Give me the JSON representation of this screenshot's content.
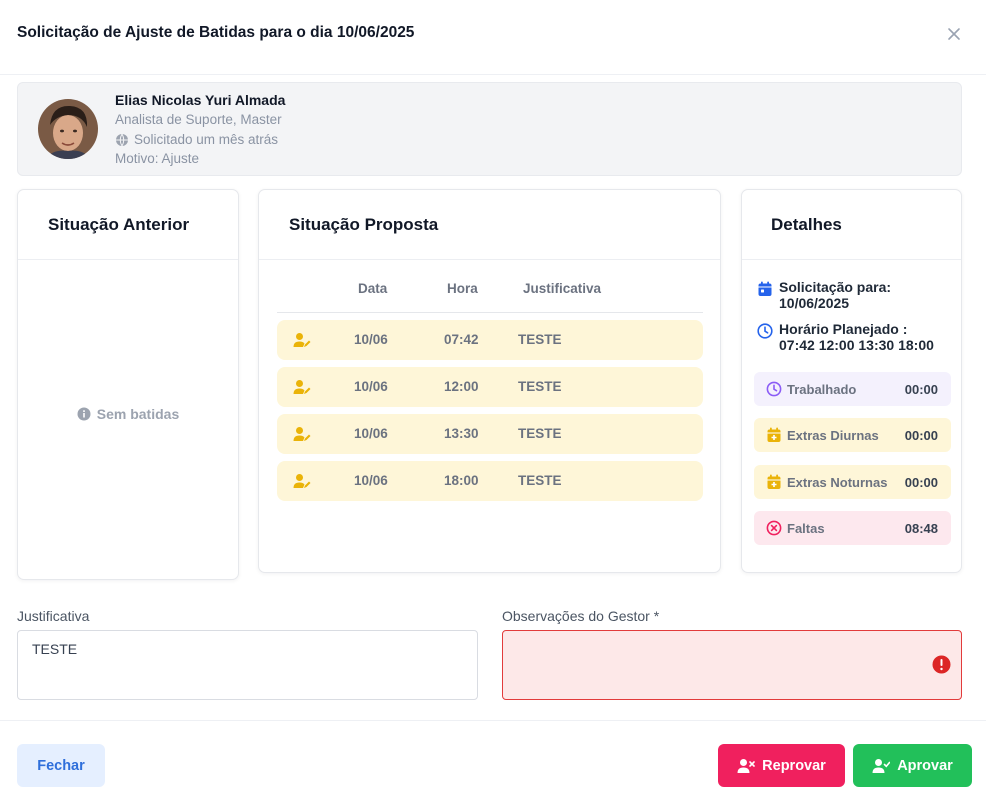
{
  "modal": {
    "title": "Solicitação de Ajuste de Batidas para o dia 10/06/2025"
  },
  "employee": {
    "name": "Elias Nicolas Yuri Almada",
    "role": "Analista de Suporte, Master",
    "requested": "Solicitado um mês atrás",
    "reason": "Motivo: Ajuste"
  },
  "previous": {
    "title": "Situação Anterior",
    "empty_text": "Sem batidas"
  },
  "proposed": {
    "title": "Situação Proposta",
    "columns": {
      "date": "Data",
      "time": "Hora",
      "justification": "Justificativa"
    },
    "rows": [
      {
        "date": "10/06",
        "time": "07:42",
        "justification": "TESTE"
      },
      {
        "date": "10/06",
        "time": "12:00",
        "justification": "TESTE"
      },
      {
        "date": "10/06",
        "time": "13:30",
        "justification": "TESTE"
      },
      {
        "date": "10/06",
        "time": "18:00",
        "justification": "TESTE"
      }
    ]
  },
  "details": {
    "title": "Detalhes",
    "request_for_label": "Solicitação para:",
    "request_for_value": "10/06/2025",
    "planned_label": "Horário Planejado :",
    "planned_value": "07:42 12:00 13:30 18:00",
    "stats": [
      {
        "label": "Trabalhado",
        "value": "00:00",
        "icon": "clock-icon",
        "bg": "#f4f1fd",
        "color": "#8b5cf6"
      },
      {
        "label": "Extras Diurnas",
        "value": "00:00",
        "icon": "calendar-plus-icon",
        "bg": "#fef6d8",
        "color": "#eab308"
      },
      {
        "label": "Extras Noturnas",
        "value": "00:00",
        "icon": "calendar-plus-icon",
        "bg": "#fef6d8",
        "color": "#eab308"
      },
      {
        "label": "Faltas",
        "value": "08:48",
        "icon": "x-circle-icon",
        "bg": "#fde8ee",
        "color": "#f0205e"
      }
    ]
  },
  "form": {
    "justification_label": "Justificativa",
    "justification_value": "TESTE",
    "manager_notes_label": "Observações do Gestor *",
    "manager_notes_value": ""
  },
  "footer": {
    "close_label": "Fechar",
    "reject_label": "Reprovar",
    "approve_label": "Aprovar"
  },
  "colors": {
    "accent_blue": "#2f6fdb",
    "reject": "#f0205e",
    "approve": "#22c05a",
    "row_highlight": "#fef6d8",
    "error": "#e23b3b"
  }
}
